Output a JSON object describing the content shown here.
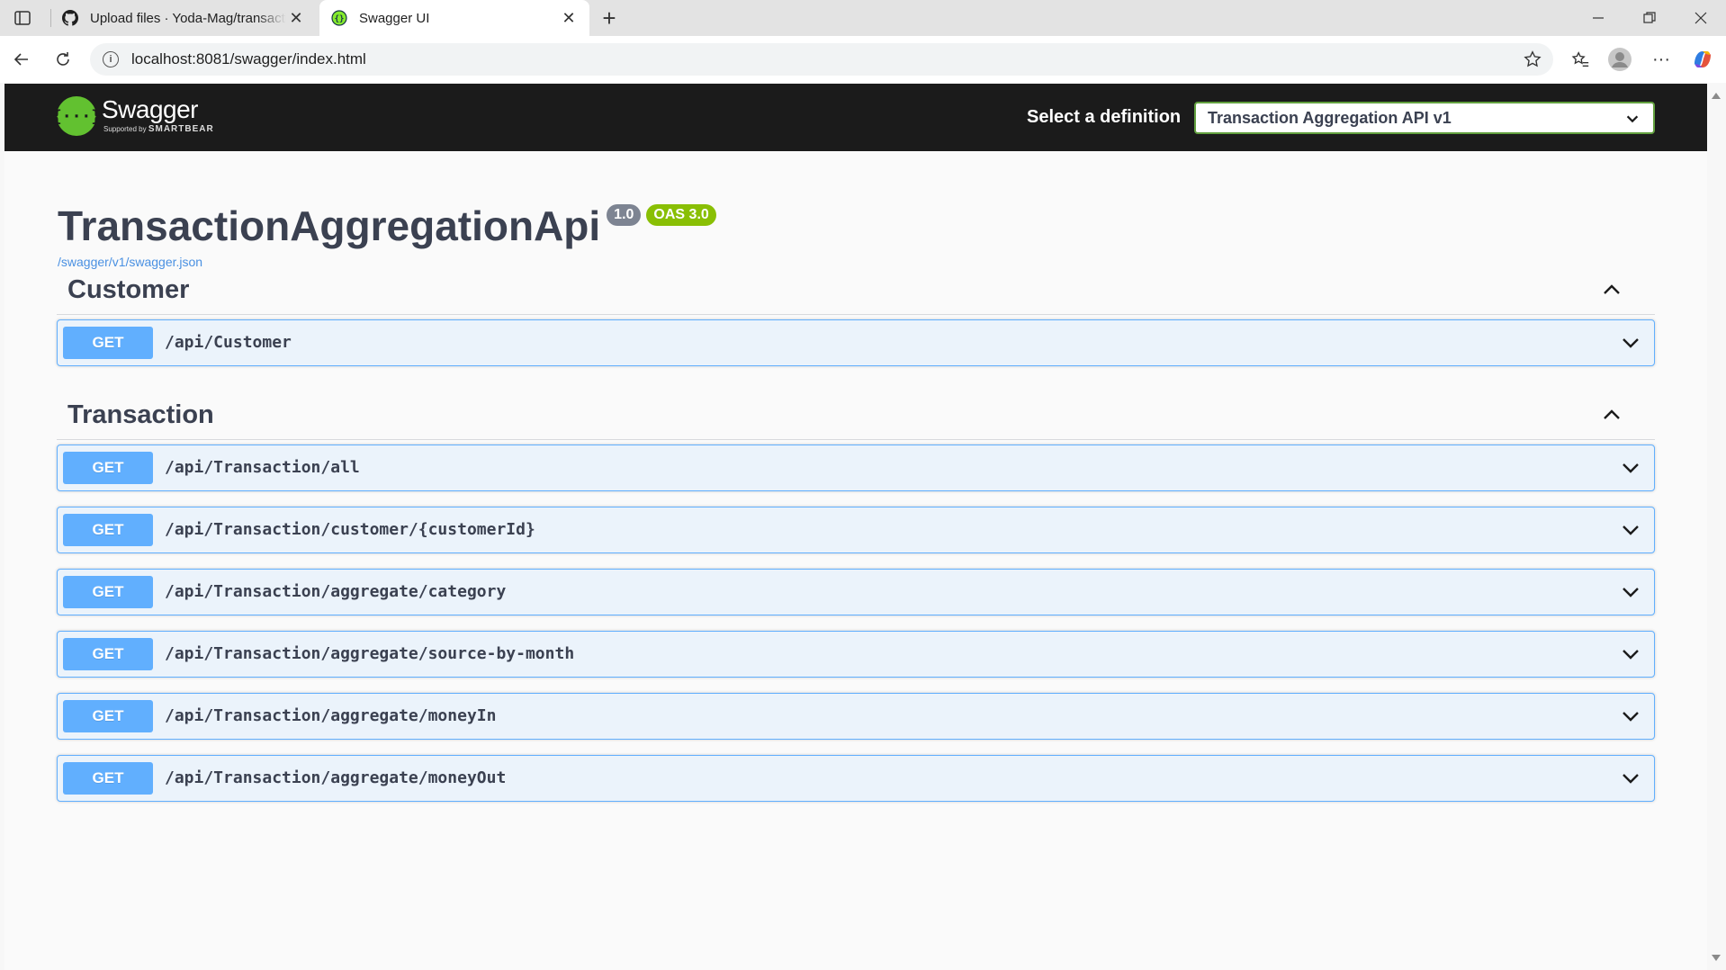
{
  "browser": {
    "tabs": [
      {
        "title": "Upload files · Yoda-Mag/transacti",
        "icon": "github-icon",
        "active": false
      },
      {
        "title": "Swagger UI",
        "icon": "swagger-icon",
        "active": true
      }
    ],
    "url": "localhost:8081/swagger/index.html"
  },
  "topbar": {
    "logo_name": "Swagger",
    "logo_sub_prefix": "Supported by",
    "logo_sub_brand": "SMARTBEAR",
    "definition_label": "Select a definition",
    "definition_selected": "Transaction Aggregation API v1"
  },
  "info": {
    "title": "TransactionAggregationApi",
    "version": "1.0",
    "oas": "OAS 3.0",
    "spec_url": "/swagger/v1/swagger.json"
  },
  "sections": [
    {
      "name": "Customer",
      "operations": [
        {
          "method": "GET",
          "path": "/api/Customer"
        }
      ]
    },
    {
      "name": "Transaction",
      "operations": [
        {
          "method": "GET",
          "path": "/api/Transaction/all"
        },
        {
          "method": "GET",
          "path": "/api/Transaction/customer/{customerId}"
        },
        {
          "method": "GET",
          "path": "/api/Transaction/aggregate/category"
        },
        {
          "method": "GET",
          "path": "/api/Transaction/aggregate/source-by-month"
        },
        {
          "method": "GET",
          "path": "/api/Transaction/aggregate/moneyIn"
        },
        {
          "method": "GET",
          "path": "/api/Transaction/aggregate/moneyOut"
        }
      ]
    }
  ],
  "colors": {
    "get_method": "#61affe",
    "swagger_green": "#62c130",
    "oas_badge": "#89bf04",
    "version_badge": "#7d8492",
    "topbar_bg": "#1b1b1b"
  }
}
